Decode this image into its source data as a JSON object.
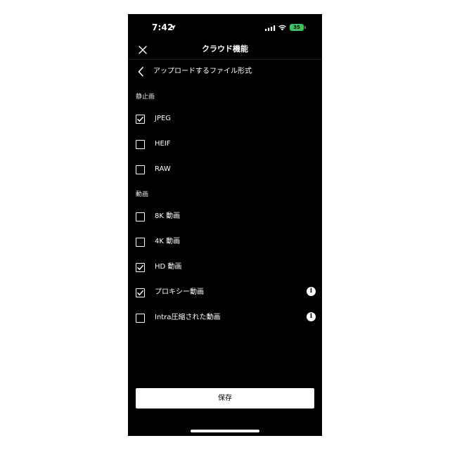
{
  "status_bar": {
    "time": "7:42",
    "battery": "35",
    "icons": [
      "location-arrow-icon",
      "signal-icon",
      "wifi-icon",
      "battery-icon"
    ]
  },
  "nav": {
    "title": "クラウド機能",
    "close_icon": "close-icon",
    "back_label": "アップロードするファイル形式",
    "back_icon": "chevron-left-icon"
  },
  "sections": {
    "still": {
      "header": "静止画",
      "options": [
        {
          "label": "JPEG",
          "checked": true
        },
        {
          "label": "HEIF",
          "checked": false
        },
        {
          "label": "RAW",
          "checked": false
        }
      ]
    },
    "video": {
      "header": "動画",
      "options": [
        {
          "label": "8K 動画",
          "checked": false,
          "info": false
        },
        {
          "label": "4K 動画",
          "checked": false,
          "info": false
        },
        {
          "label": "HD 動画",
          "checked": true,
          "info": false
        },
        {
          "label": "プロキシー動画",
          "checked": true,
          "info": true
        },
        {
          "label": "Intra圧縮された動画",
          "checked": false,
          "info": true
        }
      ]
    }
  },
  "info_glyph": "i",
  "save_label": "保存",
  "colors": {
    "background": "#000000",
    "foreground": "#ffffff",
    "battery": "#34c759"
  }
}
